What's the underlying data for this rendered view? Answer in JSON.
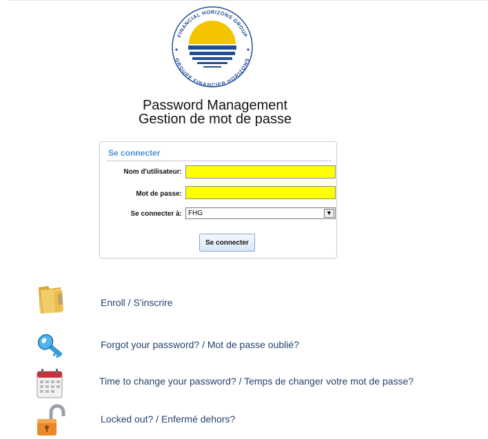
{
  "logo": {
    "text_top": "FINANCIAL HORIZONS GROUP",
    "text_bottom": "GROUPE FINANCIER HORIZONS"
  },
  "header": {
    "title_en": "Password Management",
    "title_fr": "Gestion de mot de passe"
  },
  "login": {
    "panel_title": "Se connecter",
    "username_label": "Nom d'utilisateur:",
    "username_value": "",
    "password_label": "Mot de passe:",
    "password_value": "",
    "domain_label": "Se connecter à:",
    "domain_value": "FHG",
    "submit_label": "Se connecter"
  },
  "links": {
    "enroll": "Enroll / S'inscrire",
    "forgot": "Forgot your password? / Mot de passe oublié?",
    "change": "Time to change your password?  / Temps de changer votre mot de passe?",
    "locked": "Locked out? / Enfermé dehors?"
  },
  "icons": {
    "enroll": "folder-icon",
    "forgot": "key-icon",
    "change": "calendar-icon",
    "locked": "padlock-open-icon"
  },
  "colors": {
    "input_highlight": "#ffff00",
    "panel_title": "#4a8fd0",
    "link": "#24416e",
    "logo_blue": "#1f4e96",
    "logo_yellow": "#f5c400"
  }
}
